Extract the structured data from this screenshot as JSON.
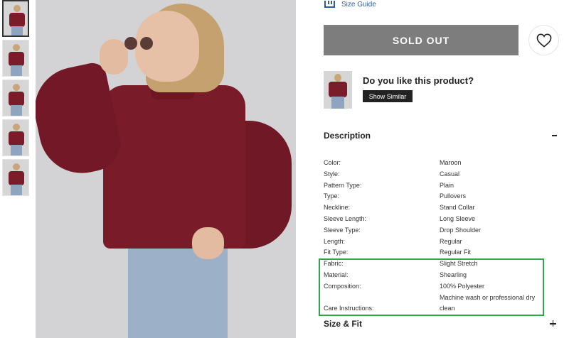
{
  "gallery": {
    "thumbnails": [
      "thumb-1",
      "thumb-2",
      "thumb-3",
      "thumb-4",
      "thumb-5"
    ],
    "active_index": 0
  },
  "size_guide": {
    "label": "Size Guide",
    "icon": "ruler-icon"
  },
  "actions": {
    "sold_out_label": "SOLD OUT",
    "wishlist_icon": "heart-icon",
    "disabled_color": "#7d7d7d"
  },
  "like_prompt": {
    "question": "Do you like this product?",
    "button": "Show Similar"
  },
  "description": {
    "title": "Description",
    "toggle_icon": "minus-icon",
    "specs": [
      {
        "label": "Color:",
        "value": "Maroon"
      },
      {
        "label": "Style:",
        "value": "Casual"
      },
      {
        "label": "Pattern Type:",
        "value": "Plain"
      },
      {
        "label": "Type:",
        "value": "Pullovers"
      },
      {
        "label": "Neckline:",
        "value": "Stand Collar"
      },
      {
        "label": "Sleeve Length:",
        "value": "Long Sleeve"
      },
      {
        "label": "Sleeve Type:",
        "value": "Drop Shoulder"
      },
      {
        "label": "Length:",
        "value": "Regular"
      },
      {
        "label": "Fit Type:",
        "value": "Regular Fit"
      },
      {
        "label": "Fabric:",
        "value": "Slight Stretch"
      },
      {
        "label": "Material:",
        "value": "Shearling"
      },
      {
        "label": "Composition:",
        "value": "100% Polyester"
      },
      {
        "label": "Care Instructions:",
        "value": "Machine wash or professional dry clean"
      }
    ]
  },
  "size_fit": {
    "title": "Size & Fit",
    "toggle_icon": "plus-icon"
  },
  "colors": {
    "highlight": "#2aa84a",
    "link": "#2f5d9a",
    "sweater": "#7a1b29"
  }
}
